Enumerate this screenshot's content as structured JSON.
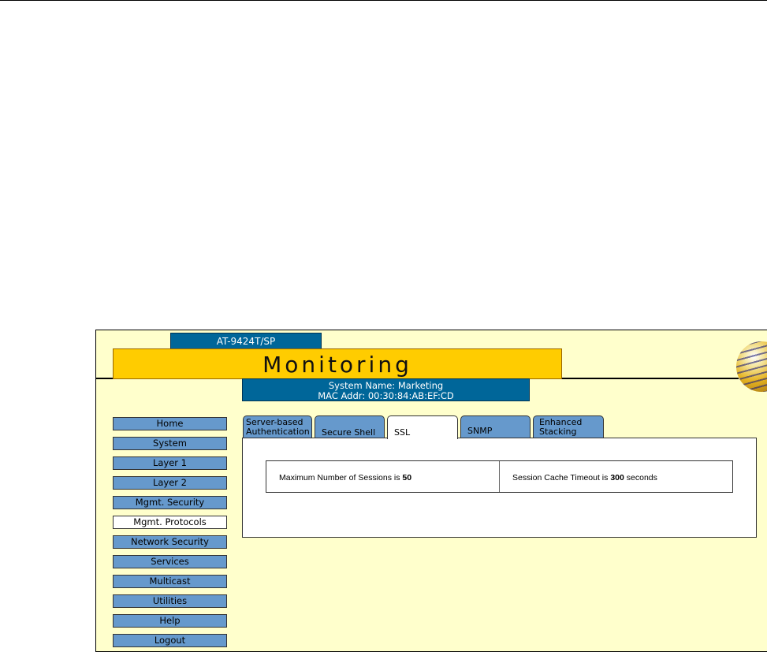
{
  "header": {
    "model": "AT-9424T/SP",
    "title": "Monitoring",
    "system_name": "System Name: Marketing",
    "mac_addr": "MAC Addr: 00:30:84:AB:EF:CD"
  },
  "nav": [
    "Home",
    "System",
    "Layer 1",
    "Layer 2",
    "Mgmt. Security",
    "Mgmt. Protocols",
    "Network Security",
    "Services",
    "Multicast",
    "Utilities",
    "Help",
    "Logout"
  ],
  "active_nav": "Mgmt. Protocols",
  "tabs": [
    {
      "l1": "Server-based",
      "l2": "Authentication"
    },
    {
      "l1": "Secure Shell"
    },
    {
      "l1": "SSL"
    },
    {
      "l1": "SNMP"
    },
    {
      "l1": "Enhanced",
      "l2": "Stacking"
    }
  ],
  "active_tab": "SSL",
  "ssl": {
    "max_sessions_label": "Maximum Number of Sessions is ",
    "max_sessions": "50",
    "timeout_label": "Session Cache Timeout is ",
    "timeout": "300",
    "timeout_unit": " seconds"
  }
}
